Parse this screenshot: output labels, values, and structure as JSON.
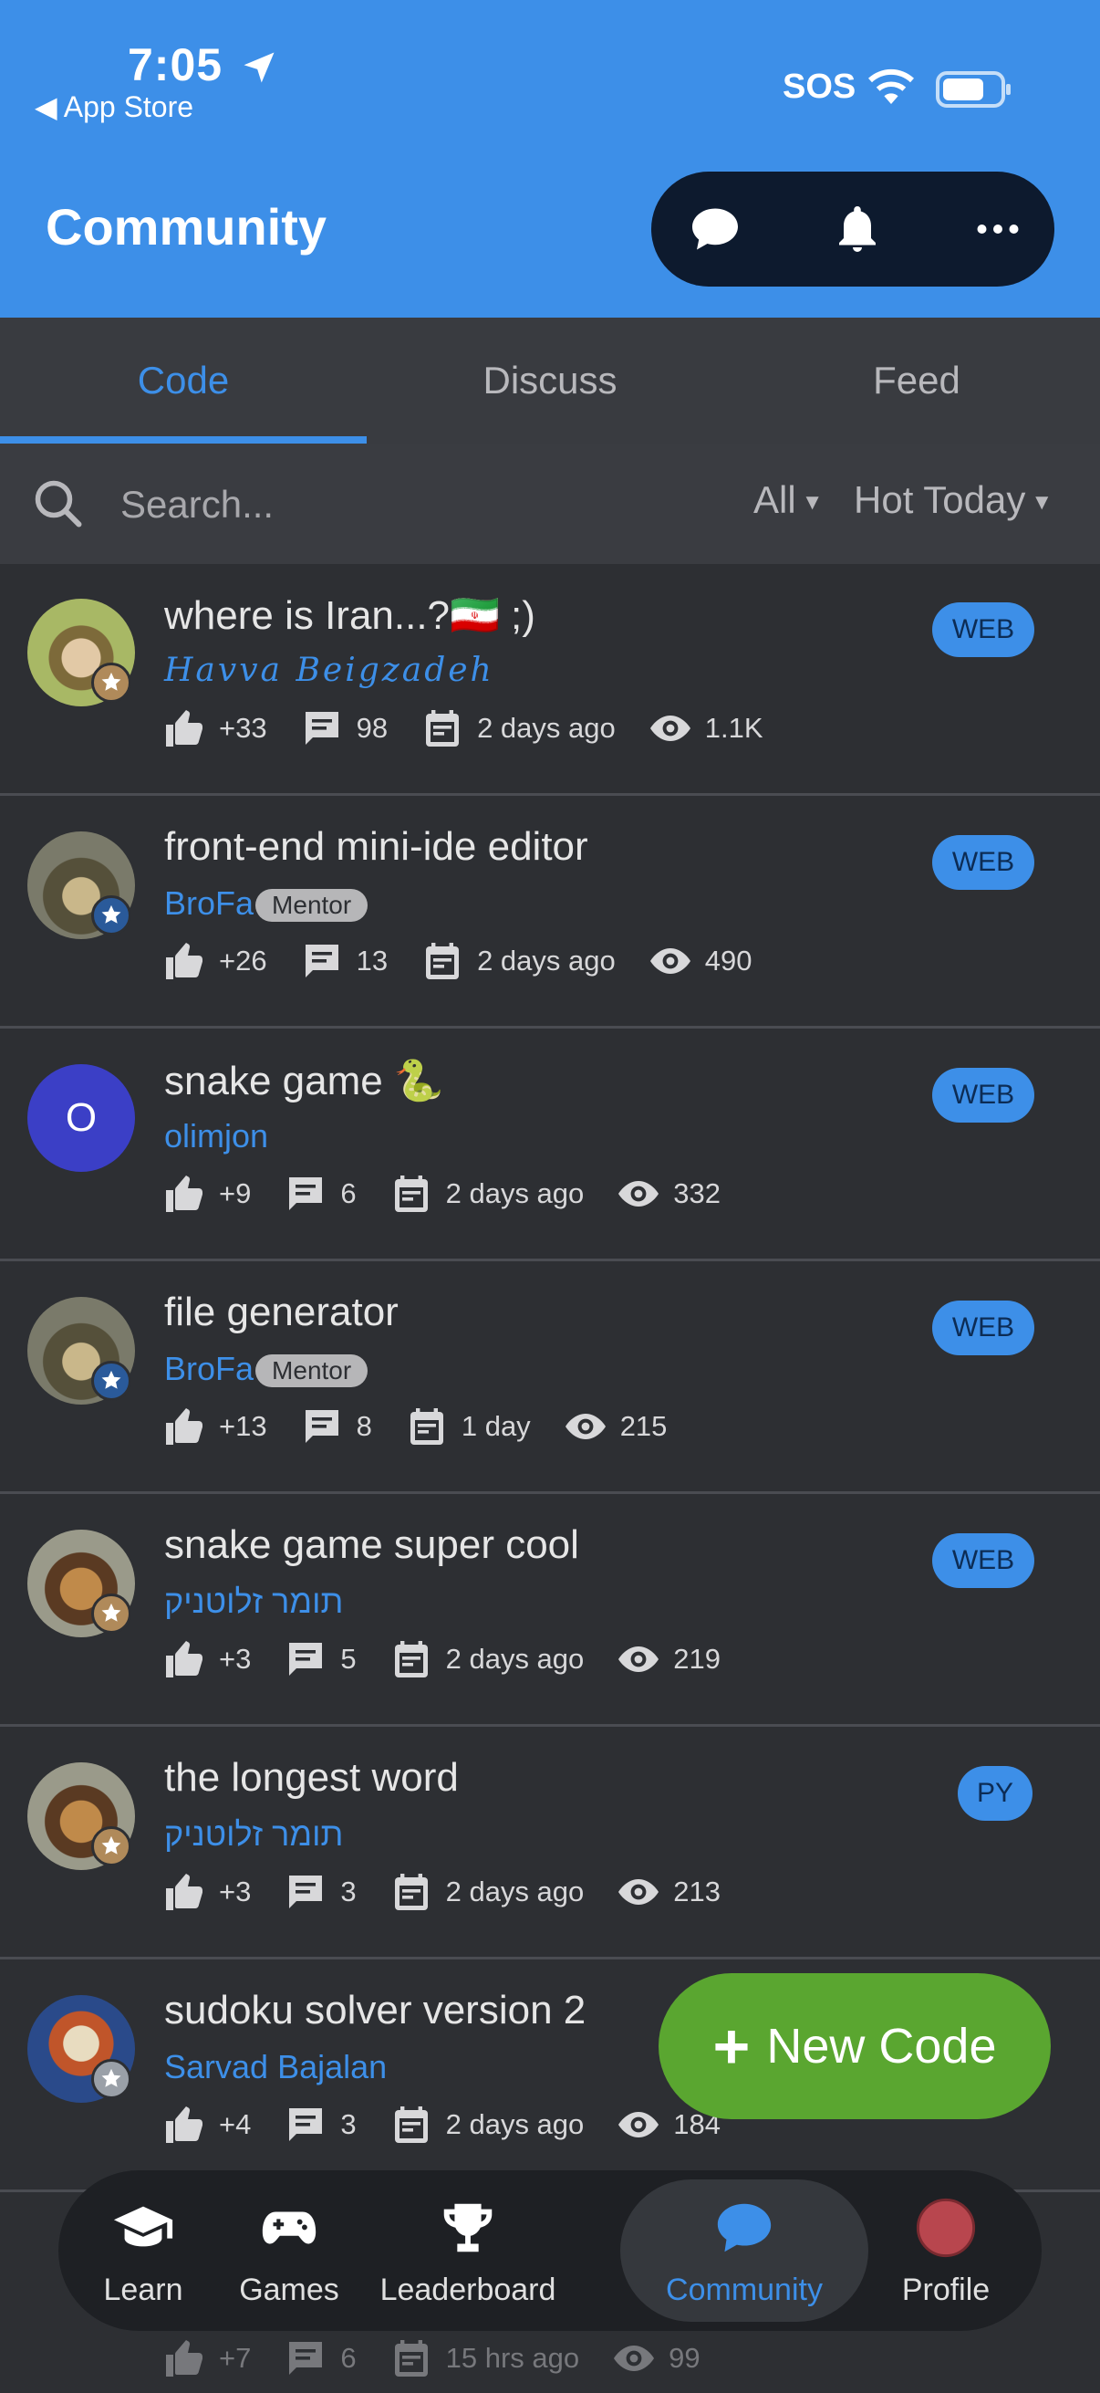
{
  "status_bar": {
    "time": "7:05",
    "back_label": "◀ App Store",
    "sos": "SOS"
  },
  "header": {
    "title": "Community"
  },
  "tabs": [
    {
      "label": "Code",
      "active": true
    },
    {
      "label": "Discuss",
      "active": false
    },
    {
      "label": "Feed",
      "active": false
    }
  ],
  "search": {
    "placeholder": "Search...",
    "filter_language": "All",
    "filter_sort": "Hot Today"
  },
  "items": [
    {
      "title": "where is Iran...?🇮🇷 ;)",
      "author": "Havva Beigzadeh",
      "lang": "WEB",
      "likes": "+33",
      "comments": "98",
      "date": "2 days ago",
      "views": "1.1K"
    },
    {
      "title": "front-end mini-ide editor",
      "author": "BroFa",
      "mentor": "Mentor",
      "lang": "WEB",
      "likes": "+26",
      "comments": "13",
      "date": "2 days ago",
      "views": "490"
    },
    {
      "title": "snake game 🐍",
      "author": "olimjon",
      "avatar_letter": "O",
      "lang": "WEB",
      "likes": "+9",
      "comments": "6",
      "date": "2 days ago",
      "views": "332"
    },
    {
      "title": "file generator",
      "author": "BroFa",
      "mentor": "Mentor",
      "lang": "WEB",
      "likes": "+13",
      "comments": "8",
      "date": "1 day",
      "views": "215"
    },
    {
      "title": "snake game super cool",
      "author": "תומר זלוטניק",
      "lang": "WEB",
      "likes": "+3",
      "comments": "5",
      "date": "2 days ago",
      "views": "219"
    },
    {
      "title": "the longest word",
      "author": "תומר זלוטניק",
      "lang": "PY",
      "likes": "+3",
      "comments": "3",
      "date": "2 days ago",
      "views": "213"
    },
    {
      "title": "sudoku solver version 2",
      "author": "Sarvad Bajalan",
      "lang": "",
      "likes": "+4",
      "comments": "3",
      "date": "2 days ago",
      "views": "184"
    }
  ],
  "partial_item": {
    "likes": "+7",
    "comments": "6",
    "date": "15 hrs ago",
    "views": "99"
  },
  "fab": {
    "plus": "+",
    "label": "New Code"
  },
  "bottom_nav": [
    {
      "label": "Learn",
      "icon": "graduation-cap-icon"
    },
    {
      "label": "Games",
      "icon": "gamepad-icon"
    },
    {
      "label": "Leaderboard",
      "icon": "trophy-icon"
    },
    {
      "label": "Community",
      "icon": "chat-bubble-icon",
      "active": true
    },
    {
      "label": "Profile",
      "icon": "profile-avatar"
    }
  ],
  "colors": {
    "accent": "#3d8fe8",
    "background": "#2d2f33",
    "fab": "#5aa630"
  }
}
